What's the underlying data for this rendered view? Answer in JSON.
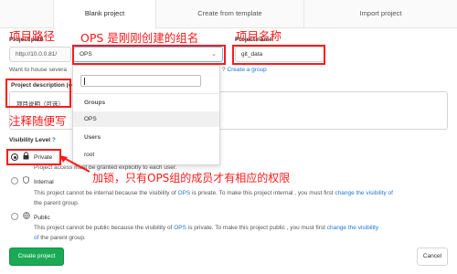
{
  "tabs": [
    "Blank project",
    "Create from template",
    "Import project"
  ],
  "form": {
    "path_label": "Project path",
    "path_prefix": "http://10.0.0.81/",
    "namespace_value": "OPS",
    "name_label": "Project name",
    "name_value": "git_data",
    "hint_text": "Want to house severa",
    "create_group_prefix": "?",
    "create_group_link": "Create a group",
    "description_label": "Project description (o",
    "description_value": "项目说明（可选）",
    "visibility_label": "Visibility Level",
    "visibility_help": "?"
  },
  "dropdown": {
    "search_placeholder": "",
    "groups_header": "Groups",
    "groups": [
      "OPS"
    ],
    "users_header": "Users",
    "users": [
      "root"
    ]
  },
  "visibility": {
    "private": {
      "label": "Private",
      "desc": "Project access must be granted explicitly to each user."
    },
    "internal": {
      "label": "Internal",
      "desc_pre": "This project cannot be internal because the visibility of ",
      "desc_link": "OPS",
      "desc_mid": " is private. To make this project internal , you must first ",
      "desc_link2": "change the visibility of",
      "desc_line2": "the parent group."
    },
    "public": {
      "label": "Public",
      "desc_pre": "This project cannot be public because the visibility of ",
      "desc_link": "OPS",
      "desc_mid": " is private. To make this project public , you must first ",
      "desc_link2": "change the visibility",
      "desc_line2": "the parent group.",
      "desc_line2_pre": "of"
    }
  },
  "buttons": {
    "create": "Create project",
    "cancel": "Cancel"
  },
  "annotations": {
    "path": "项目路径",
    "ops_group": "OPS 是刚刚创建的组名",
    "project_name": "项目名称",
    "comment": "注释随便写",
    "lock": "加锁，只有OPS组的成员才有相应的权限"
  },
  "colors": {
    "annotation": "#ff1a1a",
    "accent": "#1f78d1",
    "create_button": "#1aaa55"
  }
}
